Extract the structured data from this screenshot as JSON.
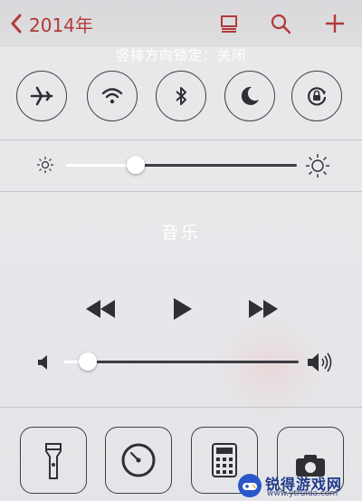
{
  "nav": {
    "back_label": "2014年",
    "icons": [
      "chevron-left-icon",
      "list-view-icon",
      "search-icon",
      "plus-icon"
    ],
    "accent_color": "#b23a3a"
  },
  "status": {
    "orientation_lock_text": "竖排方向锁定：关闭"
  },
  "toggles": [
    {
      "name": "airplane-mode-icon"
    },
    {
      "name": "wifi-icon"
    },
    {
      "name": "bluetooth-icon"
    },
    {
      "name": "do-not-disturb-moon-icon"
    },
    {
      "name": "rotation-lock-icon"
    }
  ],
  "brightness": {
    "level": 0.3
  },
  "music": {
    "title": "音乐",
    "controls": [
      "rewind-icon",
      "play-icon",
      "fast-forward-icon"
    ],
    "volume_level": 0.1
  },
  "shortcuts": [
    {
      "name": "flashlight-icon"
    },
    {
      "name": "timer-clock-icon"
    },
    {
      "name": "calculator-icon"
    },
    {
      "name": "camera-icon"
    }
  ],
  "watermark": {
    "title": "锐得游戏网",
    "url": "www.ytruida.com"
  }
}
